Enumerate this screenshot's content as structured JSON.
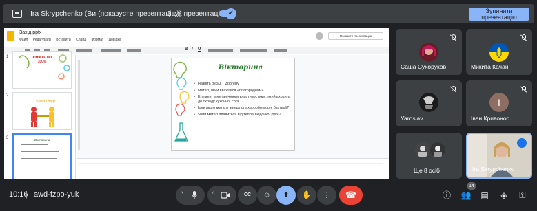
{
  "present_bar": {
    "presenter_text": "Ira Skrypchenko (Ви (показуєте презентацію))",
    "sound_label": "Звук презентації",
    "sound_on": true,
    "stop_label": "Зупинити презентацію"
  },
  "shared_doc": {
    "file_name": "Захід.pptx",
    "menu": [
      "Файл",
      "Редагувати",
      "Вставити",
      "Слайд",
      "Формат",
      "Довідка"
    ],
    "present_button": "Показати презентацію",
    "thumbnails": [
      {
        "num": "1",
        "text": "Хімік на всі 100%"
      },
      {
        "num": "2",
        "text": "Знайди пару"
      },
      {
        "num": "3",
        "text": "Вікторина"
      }
    ],
    "slide": {
      "title": "Вікторина",
      "bullets": [
        "Назвіть оксид Гідрогену.",
        "Метал, який вважався «благородним».",
        "Елемент з металічними властивостями, який входить до складу кухонної солі.",
        "Іони якого металу знищують хвороботворні бактерії?",
        "Який метал плавиться від тепла людської руки?"
      ]
    }
  },
  "participants": [
    {
      "name": "Саша Сухоруков",
      "muted": true
    },
    {
      "name": "Микита Качан",
      "muted": true
    },
    {
      "name": "Yaroslav",
      "muted": true
    },
    {
      "name": "Іван Кривонос",
      "muted": true,
      "initial": "I"
    },
    {
      "name": "Ще 8 осіб"
    },
    {
      "name": "Ira Skrypchenko"
    }
  ],
  "bottom": {
    "time": "10:16",
    "separator": "|",
    "meeting_code": "awd-fzpo-yuk",
    "participant_count": "14"
  },
  "colors": {
    "background": "#202124",
    "tile": "#3c4043",
    "accent": "#8ab4f8",
    "end_call": "#ea4335"
  },
  "icons": {
    "mic": "microphone-icon",
    "camera": "camera-icon",
    "captions": "captions-icon",
    "emoji": "emoji-icon",
    "present": "present-screen-icon",
    "hand": "raise-hand-icon",
    "more": "more-options-icon",
    "end": "end-call-icon",
    "info": "info-icon",
    "people": "people-icon",
    "chat": "chat-icon",
    "activities": "activities-icon"
  }
}
